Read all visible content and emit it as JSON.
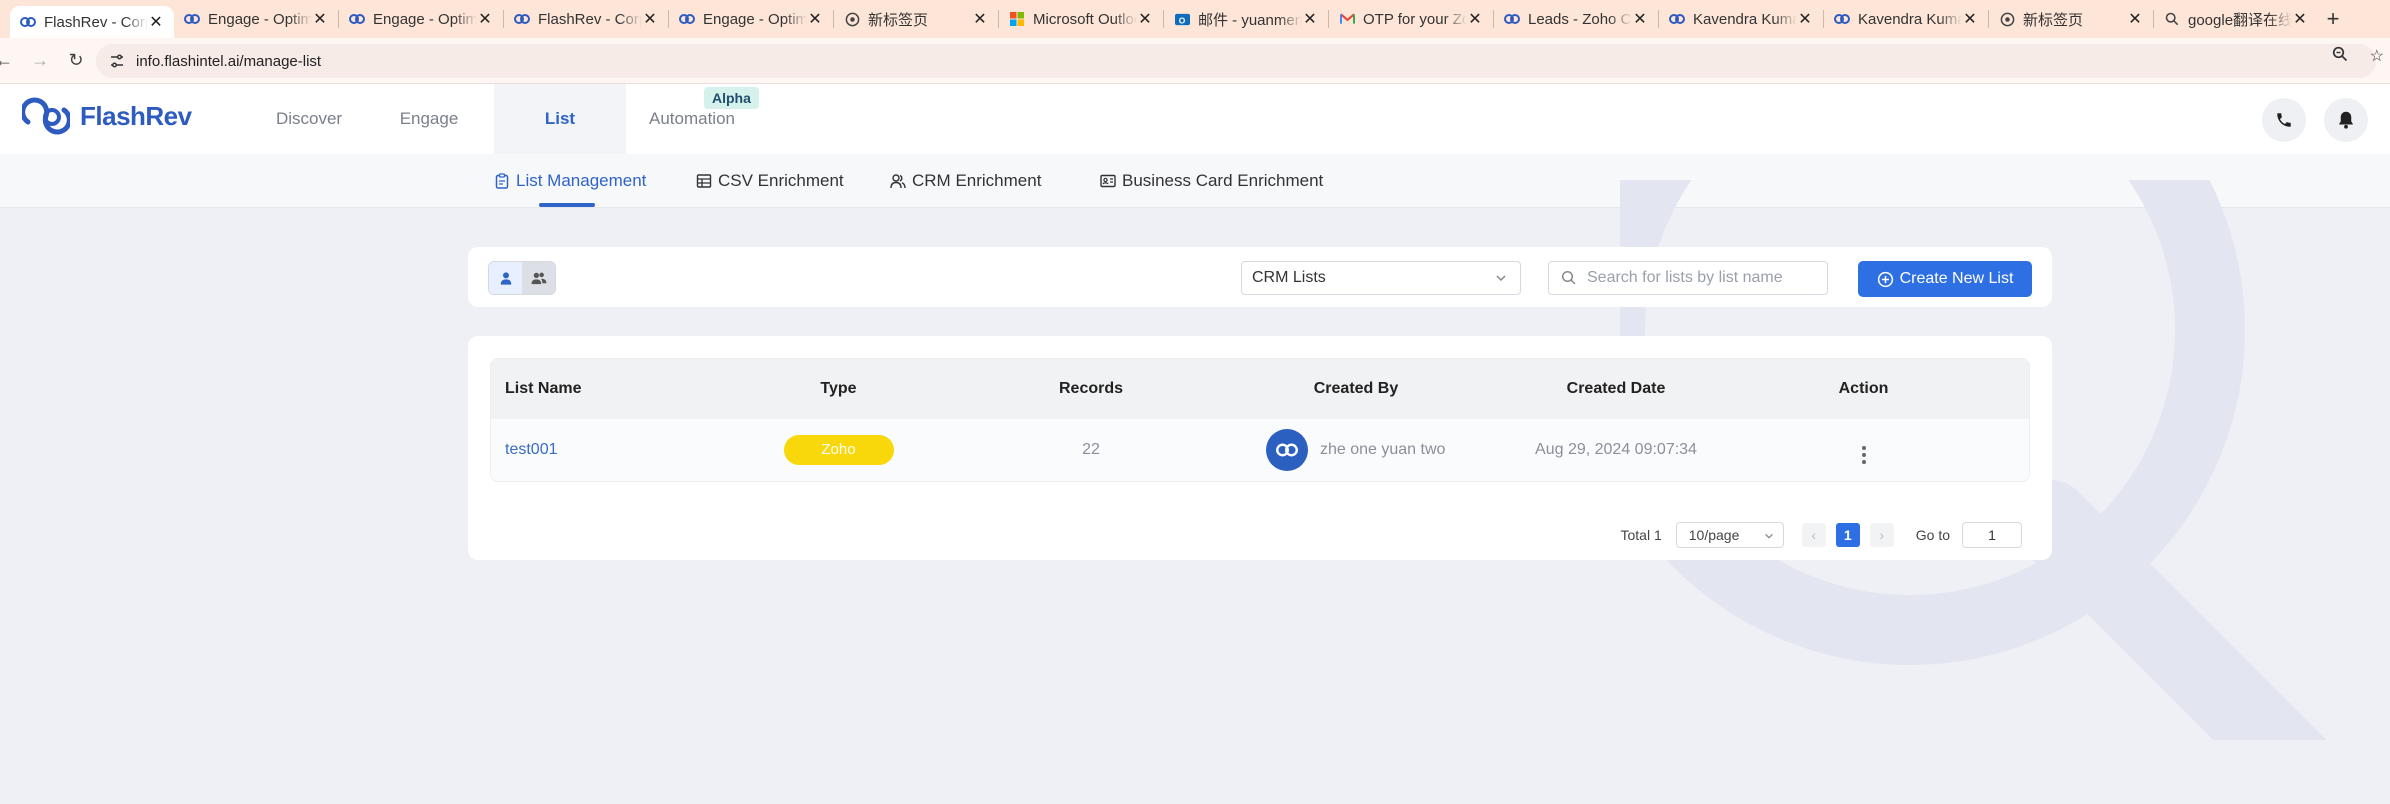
{
  "browser": {
    "tabs": [
      {
        "title": "FlashRev - Corporate",
        "icon": "flashrev-icon",
        "active": true
      },
      {
        "title": "Engage - Optimize",
        "icon": "flashrev-icon"
      },
      {
        "title": "Engage - Optimize",
        "icon": "flashrev-icon"
      },
      {
        "title": "FlashRev - Corporate",
        "icon": "flashrev-icon"
      },
      {
        "title": "Engage - Optimize",
        "icon": "flashrev-icon"
      },
      {
        "title": "新标签页",
        "icon": "globe-icon"
      },
      {
        "title": "Microsoft Outlook",
        "icon": "microsoft-icon"
      },
      {
        "title": "邮件 - yuanmeng",
        "icon": "outlook-icon"
      },
      {
        "title": "OTP for your Zoho",
        "icon": "gmail-icon"
      },
      {
        "title": "Leads - Zoho CRM",
        "icon": "flashrev-icon"
      },
      {
        "title": "Kavendra Kumar",
        "icon": "flashrev-icon"
      },
      {
        "title": "Kavendra Kumar",
        "icon": "flashrev-icon"
      },
      {
        "title": "新标签页",
        "icon": "globe-icon"
      },
      {
        "title": "google翻译在线",
        "icon": "search-icon"
      }
    ],
    "new_tab": "+",
    "url": "info.flashintel.ai/manage-list"
  },
  "app": {
    "logo_text": "FlashRev",
    "nav": {
      "discover": "Discover",
      "engage": "Engage",
      "list": "List",
      "automation": "Automation",
      "alpha": "Alpha"
    },
    "subnav": {
      "list_management": "List Management",
      "csv_enrichment": "CSV Enrichment",
      "crm_enrichment": "CRM Enrichment",
      "business_card_enrichment": "Business Card Enrichment"
    },
    "toolbar": {
      "list_source": "CRM Lists",
      "search_placeholder": "Search for lists by list name",
      "create_label": "Create New List"
    },
    "table": {
      "headers": [
        "List Name",
        "Type",
        "Records",
        "Created By",
        "Created Date",
        "Action"
      ],
      "rows": [
        {
          "name": "test001",
          "type": "Zoho",
          "records": "22",
          "created_by": "zhe one yuan two",
          "created_date": "Aug 29, 2024 09:07:34"
        }
      ]
    },
    "pagination": {
      "total": "Total 1",
      "page_size": "10/page",
      "current_page": "1",
      "goto_label": "Go to",
      "goto_value": "1"
    },
    "colors": {
      "brand": "#2f63c8",
      "primary_button": "#2f6fe4",
      "zoho_badge": "#f8d80a"
    }
  }
}
